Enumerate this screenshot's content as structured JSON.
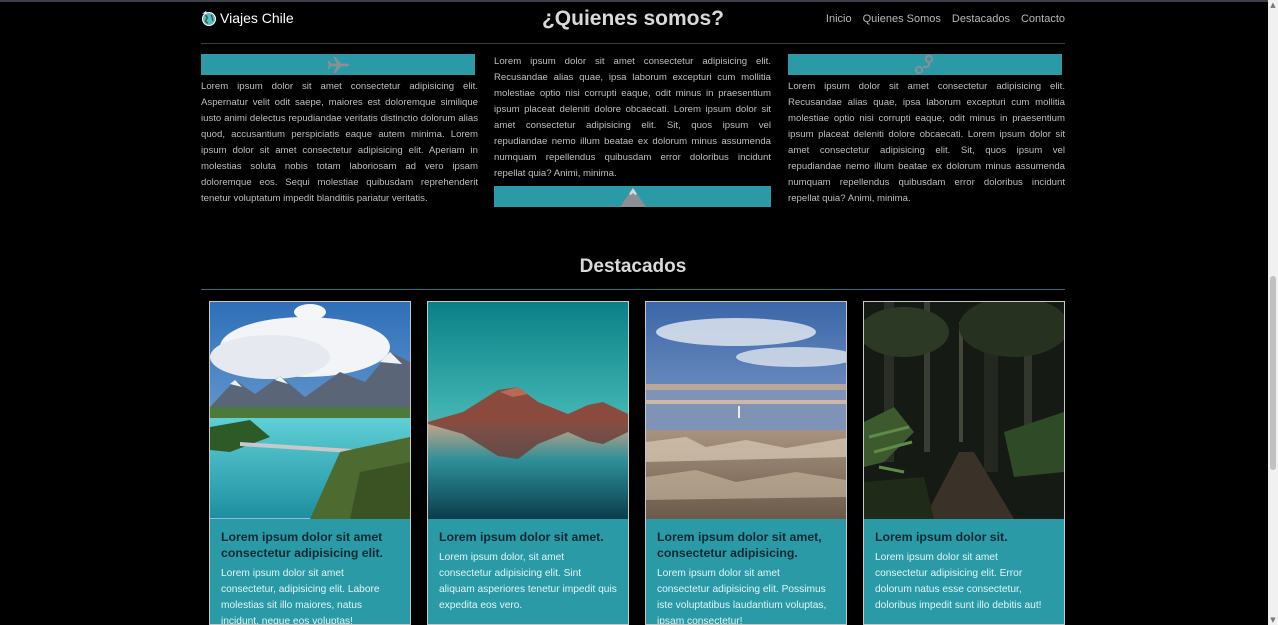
{
  "navbar": {
    "brand": "Viajes Chile",
    "links": [
      "Inicio",
      "Quienes Somos",
      "Destacados",
      "Contacto"
    ]
  },
  "about": {
    "title": "¿Quienes somos?",
    "columns": [
      {
        "icon": "airplane-icon",
        "text": "Lorem ipsum dolor sit amet consectetur adipisicing elit. Aspernatur velit odit saepe, maiores est doloremque similique iusto animi delectus repudiandae veritatis distinctio dolorum alias quod, accusantium perspiciatis eaque autem minima. Lorem ipsum dolor sit amet consectetur adipisicing elit. Aperiam in molestias soluta nobis totam laboriosam ad vero ipsam doloremque eos. Sequi molestiae quibusdam reprehenderit tenetur voluptatum impedit blanditiis pariatur veritatis."
      },
      {
        "icon": "mountain-icon",
        "text": "Lorem ipsum dolor sit amet consectetur adipisicing elit. Recusandae alias quae, ipsa laborum excepturi cum mollitia molestiae optio nisi corrupti eaque, odit minus in praesentium ipsum placeat deleniti dolore obcaecati. Lorem ipsum dolor sit amet consectetur adipisicing elit. Sit, quos ipsum vel repudiandae nemo illum beatae ex dolorum minus assumenda numquam repellendus quibusdam error doloribus incidunt repellat quia? Animi, minima."
      },
      {
        "icon": "route-icon",
        "text": "Lorem ipsum dolor sit amet consectetur adipisicing elit. Recusandae alias quae, ipsa laborum excepturi cum mollitia molestiae optio nisi corrupti eaque, odit minus in praesentium ipsum placeat deleniti dolore obcaecati. Lorem ipsum dolor sit amet consectetur adipisicing elit. Sit, quos ipsum vel repudiandae nemo illum beatae ex dolorum minus assumenda numquam repellendus quibusdam error doloribus incidunt repellat quia? Animi, minima."
      }
    ]
  },
  "destacados": {
    "title": "Destacados",
    "cards": [
      {
        "image": "patagonia-lake-mountains",
        "title": "Lorem ipsum dolor sit amet consectetur adipisicing elit.",
        "text": "Lorem ipsum dolor sit amet consectetur, adipisicing elit. Labore molestias sit illo maiores, natus incidunt, neque eos voluptas!"
      },
      {
        "image": "volcano-reflection",
        "title": "Lorem ipsum dolor sit amet.",
        "text": "Lorem ipsum dolor, sit amet consectetur adipisicing elit. Sint aliquam asperiores tenetur impedit quis expedita eos vero."
      },
      {
        "image": "salt-flat-lagoon",
        "title": "Lorem ipsum dolor sit amet, consectetur adipisicing.",
        "text": "Lorem ipsum dolor sit amet consectetur adipisicing elit. Possimus iste voluptatibus laudantium voluptas, ipsam consectetur!"
      },
      {
        "image": "rainforest-trail",
        "title": "Lorem ipsum dolor sit.",
        "text": "Lorem ipsum dolor sit amet consectetur adipisicing elit. Error dolorum natus esse consectetur, doloribus impedit sunt illo debitis aut!"
      }
    ]
  },
  "colors": {
    "background": "#000000",
    "accent": "#2a9aa6",
    "card_title": "#102a33"
  }
}
